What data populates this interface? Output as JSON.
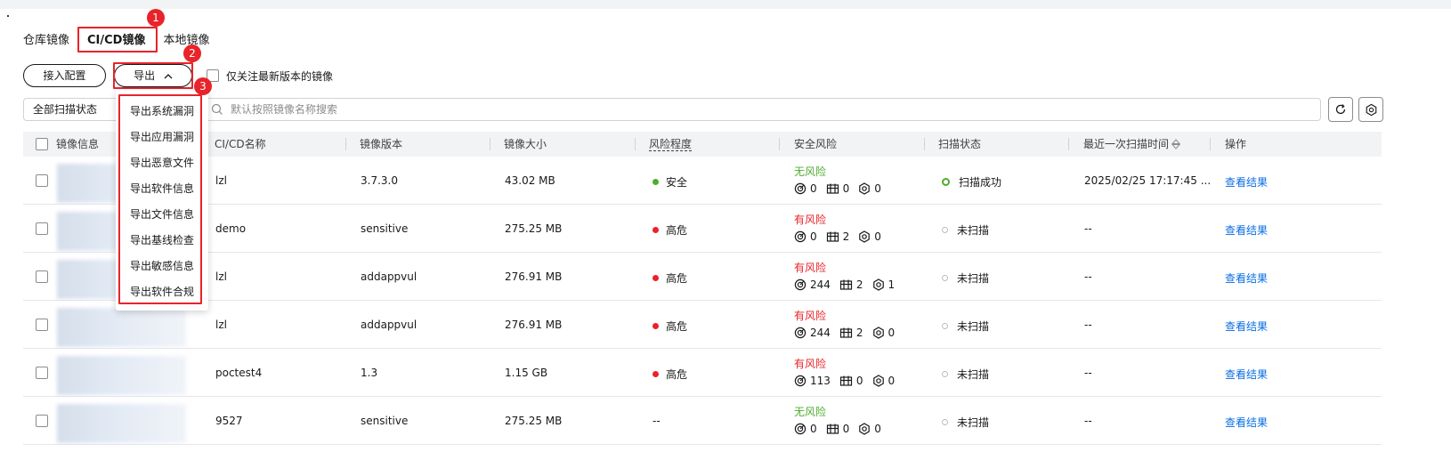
{
  "tabs": [
    {
      "label": "仓库镜像"
    },
    {
      "label": "CI/CD镜像"
    },
    {
      "label": "本地镜像"
    }
  ],
  "actions": {
    "access_config": "接入配置",
    "export": "导出",
    "latest_only": "仅关注最新版本的镜像"
  },
  "filter": {
    "scan_status": "全部扫描状态",
    "search_placeholder": "默认按照镜像名称搜索"
  },
  "annotations": [
    "1",
    "2",
    "3"
  ],
  "export_menu": [
    "导出系统漏洞",
    "导出应用漏洞",
    "导出恶意文件",
    "导出软件信息",
    "导出文件信息",
    "导出基线检查",
    "导出敏感信息",
    "导出软件合规"
  ],
  "table": {
    "columns": {
      "image_info": "镜像信息",
      "cicd_name": "CI/CD名称",
      "version": "镜像版本",
      "size": "镜像大小",
      "risk_level": "风险程度",
      "security_risk": "安全风险",
      "scan_status": "扫描状态",
      "last_scan": "最近一次扫描时间",
      "action": "操作"
    },
    "rows": [
      {
        "name": "lzl",
        "version": "3.7.3.0",
        "size": "43.02 MB",
        "risk": "安全",
        "risk_color": "#4fad2e",
        "sec_title": "无风险",
        "sec_color": "#4fad2e",
        "vuln": "0",
        "bl": "0",
        "mal": "0",
        "status": "扫描成功",
        "status_ok": true,
        "time": "2025/02/25 17:17:45 ...",
        "action": "查看结果"
      },
      {
        "name": "demo",
        "version": "sensitive",
        "size": "275.25 MB",
        "risk": "高危",
        "risk_color": "#e8232a",
        "sec_title": "有风险",
        "sec_color": "#e8232a",
        "vuln": "0",
        "bl": "2",
        "mal": "0",
        "status": "未扫描",
        "status_ok": false,
        "time": "--",
        "action": "查看结果"
      },
      {
        "name": "lzl",
        "version": "addappvul",
        "size": "276.91 MB",
        "risk": "高危",
        "risk_color": "#e8232a",
        "sec_title": "有风险",
        "sec_color": "#e8232a",
        "vuln": "244",
        "bl": "2",
        "mal": "1",
        "status": "未扫描",
        "status_ok": false,
        "time": "--",
        "action": "查看结果"
      },
      {
        "name": "lzl",
        "version": "addappvul",
        "size": "276.91 MB",
        "risk": "高危",
        "risk_color": "#e8232a",
        "sec_title": "有风险",
        "sec_color": "#e8232a",
        "vuln": "244",
        "bl": "2",
        "mal": "0",
        "status": "未扫描",
        "status_ok": false,
        "time": "--",
        "action": "查看结果"
      },
      {
        "name": "poctest4",
        "version": "1.3",
        "size": "1.15 GB",
        "risk": "高危",
        "risk_color": "#e8232a",
        "sec_title": "有风险",
        "sec_color": "#e8232a",
        "vuln": "113",
        "bl": "0",
        "mal": "0",
        "status": "未扫描",
        "status_ok": false,
        "time": "--",
        "action": "查看结果"
      },
      {
        "name": "9527",
        "version": "sensitive",
        "size": "275.25 MB",
        "risk": "--",
        "risk_color": "",
        "sec_title": "无风险",
        "sec_color": "#4fad2e",
        "vuln": "0",
        "bl": "0",
        "mal": "0",
        "status": "未扫描",
        "status_ok": false,
        "time": "--",
        "action": "查看结果"
      }
    ]
  }
}
